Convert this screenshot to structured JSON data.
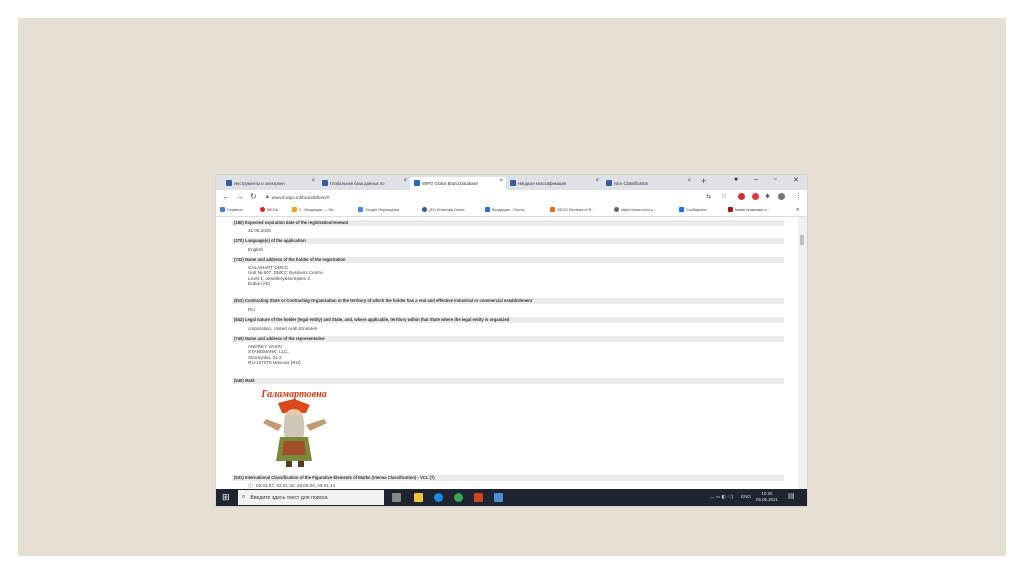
{
  "browser": {
    "tabs": [
      {
        "label": "Инструменты и электронн",
        "active": false
      },
      {
        "label": "Глобальная база данных по",
        "active": false
      },
      {
        "label": "WIPO Global Brand Database",
        "active": true
      },
      {
        "label": "Ниццкая классификация",
        "active": false
      },
      {
        "label": "Nice Classification",
        "active": false
      }
    ],
    "url": "www3.wipo.int/branddb/en/#",
    "bookmarks": [
      "Сервисы",
      "MEGA",
      "2 - Входящие — Ян...",
      "Google Переводчик",
      "(42) Игнатова Ольга",
      "Входящие - Почта...",
      "OECD Reviews of R...",
      "https://www.oecd.o...",
      "Сообщения",
      "Какие правовые и..."
    ]
  },
  "record": {
    "sections": [
      {
        "code": "(180)",
        "title": "Expected expiration date of the registration/renewal",
        "lines": [
          "31.05.2026"
        ]
      },
      {
        "code": "(270)",
        "title": "Language(s) of the application",
        "lines": [
          "English"
        ]
      },
      {
        "code": "(732)",
        "title": "Name and address of the holder of the registration",
        "lines": [
          "GALAMART DMCC",
          "Unit № 607, DMCC Business Centre,",
          "Level 1, Jewellery&Gemplex 3",
          "Dubai (AE)"
        ]
      },
      {
        "code": "(812)",
        "title": "Contracting State or Contracting Organization in the territory of which the holder has a real and effective industrial or commercial establishment",
        "lines": [
          "RU"
        ]
      },
      {
        "code": "(842)",
        "title": "Legal nature of the holder (legal entity) and State, and, where applicable, territory within that State where the legal entity is organized",
        "lines": [
          "corporation, United Arab Emirates"
        ]
      },
      {
        "code": "(740)",
        "title": "Name and address of the representative",
        "lines": [
          "ANDREY VASIN",
          "STANDMARK, LLC,",
          "Stromynka, 21-2",
          "RU-107076 Moscow (RU)"
        ]
      },
      {
        "code": "(540)",
        "title": "Mark",
        "lines": []
      },
      {
        "code": "(531)",
        "title": "International Classification of the Figurative Elements of Marks (Vienna Classification) - VCL (7)",
        "lines": [
          "02.01.07, 02.01.30, 28.05.00, 29.01.14"
        ]
      }
    ],
    "mark_text": "Галамартовна"
  },
  "taskbar": {
    "search_placeholder": "Введите здесь текст для поиска",
    "lang": "ENG",
    "time": "10:25",
    "date": "05.05.2021"
  }
}
